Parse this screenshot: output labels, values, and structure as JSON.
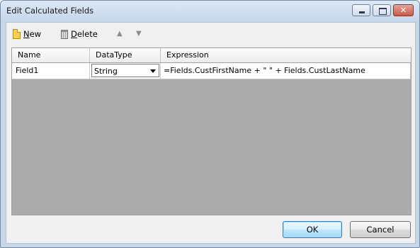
{
  "window": {
    "title": "Edit Calculated Fields"
  },
  "toolbar": {
    "new_label": "New",
    "delete_label": "Delete",
    "icons": [
      "new-document-icon",
      "trash-icon",
      "arrow-up-icon",
      "arrow-down-icon"
    ]
  },
  "grid": {
    "columns": [
      "Name",
      "DataType",
      "Expression"
    ],
    "rows": [
      {
        "name": "Field1",
        "data_type": "String",
        "expression": "=Fields.CustFirstName + \" \" + Fields.CustLastName"
      }
    ]
  },
  "footer": {
    "ok_label": "OK",
    "cancel_label": "Cancel"
  }
}
